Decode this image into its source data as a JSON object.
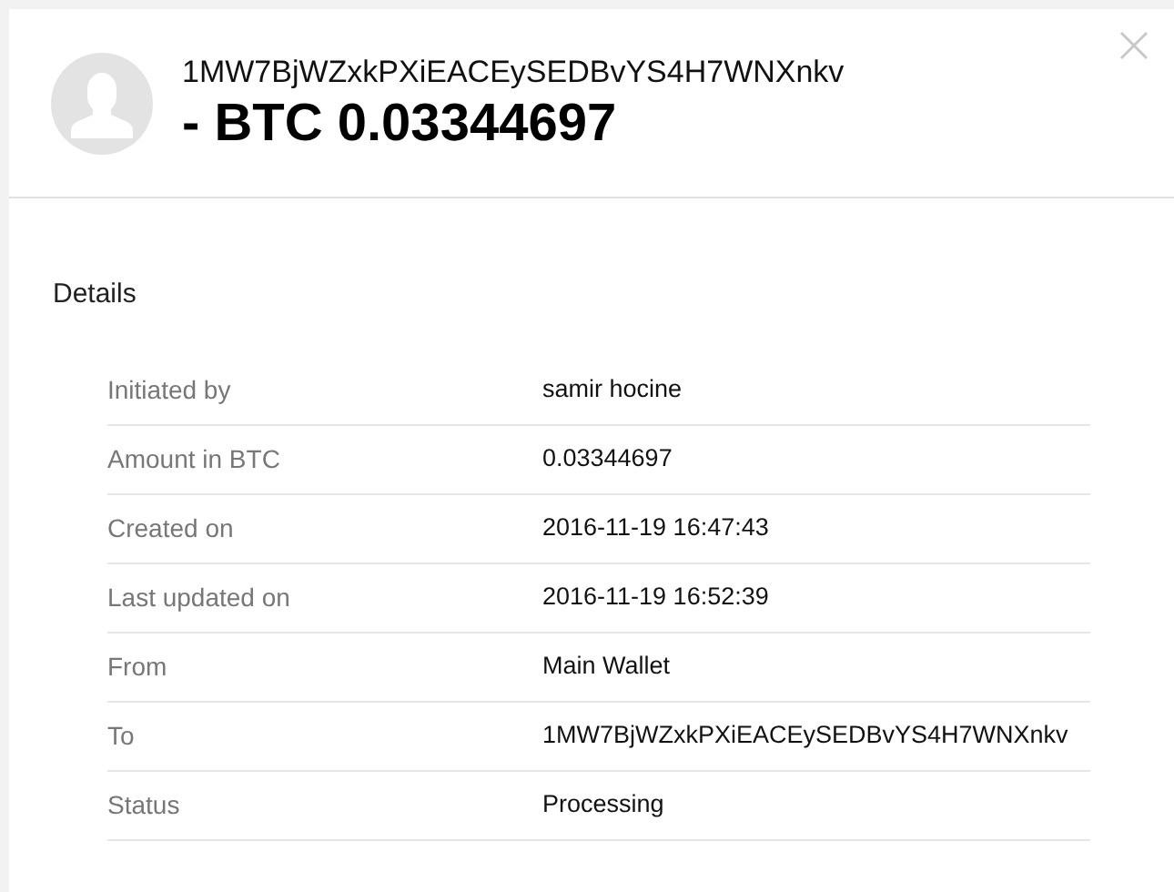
{
  "header": {
    "address": "1MW7BjWZxkPXiEACEySEDBvYS4H7WNXnkv",
    "amount": "- BTC 0.03344697"
  },
  "details": {
    "title": "Details",
    "rows": [
      {
        "label": "Initiated by",
        "value": "samir hocine"
      },
      {
        "label": "Amount in BTC",
        "value": "0.03344697"
      },
      {
        "label": "Created on",
        "value": "2016-11-19 16:47:43"
      },
      {
        "label": "Last updated on",
        "value": "2016-11-19 16:52:39"
      },
      {
        "label": "From",
        "value": "Main Wallet"
      },
      {
        "label": "To",
        "value": "1MW7BjWZxkPXiEACEySEDBvYS4H7WNXnkv"
      },
      {
        "label": "Status",
        "value": "Processing"
      }
    ]
  }
}
